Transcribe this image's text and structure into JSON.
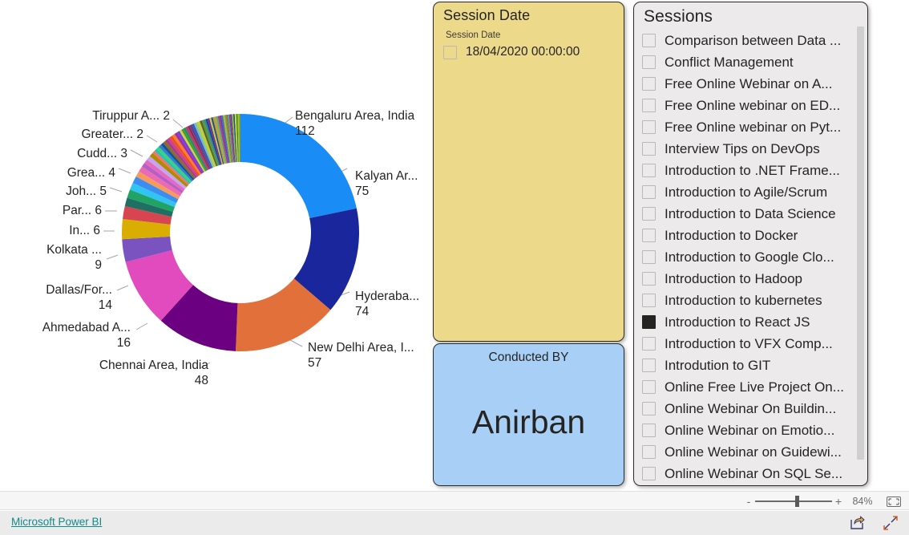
{
  "chart_data": {
    "type": "pie",
    "variant": "donut",
    "title": "",
    "labels_shown": [
      {
        "category": "Bengaluru Area, India",
        "value": 112,
        "display": "Bengaluru Area, India",
        "color": "#1a8cf5"
      },
      {
        "category": "Kalyan Ar...",
        "value": 75,
        "display": "Kalyan Ar...",
        "color": "#1a269c"
      },
      {
        "category": "Hyderaba...",
        "value": 74,
        "display": "Hyderaba...",
        "color": "#e2703a"
      },
      {
        "category": "New Delhi Area, I...",
        "value": 57,
        "display": "New Delhi Area, I...",
        "color": "#6b0080"
      },
      {
        "category": "Chennai Area, India",
        "value": 48,
        "display": "Chennai Area, India",
        "color": "#e14bbd"
      },
      {
        "category": "Ahmedabad A...",
        "value": 16,
        "display": "Ahmedabad A...",
        "color": "#7b53c1"
      },
      {
        "category": "Dallas/For...",
        "value": 14,
        "display": "Dallas/For...",
        "color": "#d9ae00"
      },
      {
        "category": "Kolkata ...",
        "value": 9,
        "display": "Kolkata ...",
        "color": "#d64550"
      },
      {
        "category": "In... 6",
        "value": 6,
        "display": "In...",
        "color": "#1f6f63"
      },
      {
        "category": "Par... 6",
        "value": 6,
        "display": "Par...",
        "color": "#21a366"
      },
      {
        "category": "Joh... 5",
        "value": 5,
        "display": "Joh...",
        "color": "#31c4f3"
      },
      {
        "category": "Grea... 4",
        "value": 4,
        "display": "Grea...",
        "color": "#3b8ef0"
      },
      {
        "category": "Cudd... 3",
        "value": 3,
        "display": "Cudd...",
        "color": "#f79a5b"
      },
      {
        "category": "Greater... 2",
        "value": 2,
        "display": "Greater...",
        "color": "#b75fc4"
      },
      {
        "category": "Tiruppur A... 2",
        "value": 2,
        "display": "Tiruppur A...",
        "color": "#e768c0"
      }
    ],
    "segments": [
      {
        "value": 112,
        "color": "#1a8cf5"
      },
      {
        "value": 75,
        "color": "#1a269c"
      },
      {
        "value": 74,
        "color": "#e2703a"
      },
      {
        "value": 57,
        "color": "#6b0080"
      },
      {
        "value": 48,
        "color": "#e14bbd"
      },
      {
        "value": 16,
        "color": "#7b53c1"
      },
      {
        "value": 14,
        "color": "#d9ae00"
      },
      {
        "value": 9,
        "color": "#d64550"
      },
      {
        "value": 6,
        "color": "#1f6f63"
      },
      {
        "value": 6,
        "color": "#21a366"
      },
      {
        "value": 5,
        "color": "#31c4f3"
      },
      {
        "value": 5,
        "color": "#3b8ef0"
      },
      {
        "value": 4,
        "color": "#f79a5b"
      },
      {
        "value": 4,
        "color": "#e96bb4"
      },
      {
        "value": 3,
        "color": "#b75fc4"
      },
      {
        "value": 3,
        "color": "#e768c0"
      },
      {
        "value": 3,
        "color": "#c3a6f0"
      },
      {
        "value": 3,
        "color": "#b08a00"
      },
      {
        "value": 2,
        "color": "#f2736e"
      },
      {
        "value": 2,
        "color": "#17c7b0"
      },
      {
        "value": 2,
        "color": "#3fd17a"
      },
      {
        "value": 2,
        "color": "#2d7fd6"
      },
      {
        "value": 2,
        "color": "#1a4f9c"
      },
      {
        "value": 2,
        "color": "#8c6d1f"
      },
      {
        "value": 2,
        "color": "#a33c8f"
      },
      {
        "value": 2,
        "color": "#d1408a"
      },
      {
        "value": 2,
        "color": "#f24e1e"
      },
      {
        "value": 2,
        "color": "#ff7c2b"
      },
      {
        "value": 2,
        "color": "#9b2fb0"
      },
      {
        "value": 2,
        "color": "#7a3fd4"
      },
      {
        "value": 1.6,
        "color": "#c9d93a"
      },
      {
        "value": 1.6,
        "color": "#4a9b2f"
      },
      {
        "value": 1.6,
        "color": "#1f8f6b"
      },
      {
        "value": 1.6,
        "color": "#c4356b"
      },
      {
        "value": 1.6,
        "color": "#8f2f4f"
      },
      {
        "value": 1.6,
        "color": "#5d3fa0"
      },
      {
        "value": 1.6,
        "color": "#2f5fa8"
      },
      {
        "value": 1.6,
        "color": "#7fb3d9"
      },
      {
        "value": 1.4,
        "color": "#9bd93a"
      },
      {
        "value": 1.4,
        "color": "#d9c23a"
      },
      {
        "value": 1.4,
        "color": "#3a6b2f"
      },
      {
        "value": 1.4,
        "color": "#6b8f2f"
      },
      {
        "value": 1.4,
        "color": "#2f8f8f"
      },
      {
        "value": 1.4,
        "color": "#1f3f8f"
      },
      {
        "value": 1.4,
        "color": "#7a2f8f"
      },
      {
        "value": 1.2,
        "color": "#b3d93a"
      },
      {
        "value": 1.2,
        "color": "#3a3a8f"
      },
      {
        "value": 1.2,
        "color": "#8fb33a"
      },
      {
        "value": 1.2,
        "color": "#d98f3a"
      },
      {
        "value": 1.2,
        "color": "#3ab38f"
      },
      {
        "value": 1.2,
        "color": "#b33a6b"
      },
      {
        "value": 1.2,
        "color": "#6b3ab3"
      },
      {
        "value": 1.2,
        "color": "#3a6bb3"
      },
      {
        "value": 1.2,
        "color": "#b3b33a"
      },
      {
        "value": 1.0,
        "color": "#5fa83a"
      },
      {
        "value": 1.0,
        "color": "#a85f3a"
      },
      {
        "value": 1.0,
        "color": "#3aa8a8"
      },
      {
        "value": 1.0,
        "color": "#a83a5f"
      },
      {
        "value": 1.0,
        "color": "#5f3aa8"
      },
      {
        "value": 1.0,
        "color": "#86c232"
      },
      {
        "value": 1.0,
        "color": "#2d4a8c"
      },
      {
        "value": 1.0,
        "color": "#c2e832"
      },
      {
        "value": 1.0,
        "color": "#4f7f1f"
      },
      {
        "value": 1.0,
        "color": "#9cc63a"
      },
      {
        "value": 1.0,
        "color": "#7a9c1f"
      }
    ]
  },
  "session_date_slicer": {
    "title": "Session Date",
    "field_label": "Session Date",
    "items": [
      {
        "label": "18/04/2020 00:00:00",
        "checked": false
      }
    ],
    "background_color": "#ecd98a"
  },
  "conducted_by_card": {
    "title": "Conducted BY",
    "value": "Anirban",
    "background_color": "#a8d0f7"
  },
  "sessions_slicer": {
    "title": "Sessions",
    "background_color": "#eceaea",
    "items": [
      {
        "label": "Comparison between Data ...",
        "checked": false
      },
      {
        "label": "Conflict Management",
        "checked": false
      },
      {
        "label": "Free Online Webinar on A...",
        "checked": false
      },
      {
        "label": "Free Online webinar on ED...",
        "checked": false
      },
      {
        "label": "Free Online webinar on Pyt...",
        "checked": false
      },
      {
        "label": "Interview Tips on DevOps",
        "checked": false
      },
      {
        "label": "Introduction to .NET Frame...",
        "checked": false
      },
      {
        "label": "Introduction to Agile/Scrum",
        "checked": false
      },
      {
        "label": "Introduction to Data Science",
        "checked": false
      },
      {
        "label": "Introduction to Docker",
        "checked": false
      },
      {
        "label": "Introduction to Google Clo...",
        "checked": false
      },
      {
        "label": "Introduction to Hadoop",
        "checked": false
      },
      {
        "label": "Introduction to kubernetes",
        "checked": false
      },
      {
        "label": "Introduction to React JS",
        "checked": true
      },
      {
        "label": "Introduction to VFX Comp...",
        "checked": false
      },
      {
        "label": "Introdution to GIT",
        "checked": false
      },
      {
        "label": "Online Free Live Project On...",
        "checked": false
      },
      {
        "label": "Online Webinar On Buildin...",
        "checked": false
      },
      {
        "label": "Online Webinar on Emotio...",
        "checked": false
      },
      {
        "label": "Online Webinar on Guidewi...",
        "checked": false
      },
      {
        "label": "Online Webinar On SQL Se...",
        "checked": false
      }
    ]
  },
  "zoom_bar": {
    "minus_label": "-",
    "plus_label": "+",
    "zoom_level": "84%",
    "fit_icon": "fit-to-page-icon"
  },
  "footer": {
    "brand_link": "Microsoft Power BI",
    "share_icon": "share-icon",
    "fullscreen_icon": "fullscreen-icon"
  },
  "colors": {
    "link": "#118a8a",
    "text": "#252423",
    "slicer_yellow": "#ecd98a",
    "slicer_blue": "#a8d0f7",
    "slicer_gray": "#eceaea"
  }
}
